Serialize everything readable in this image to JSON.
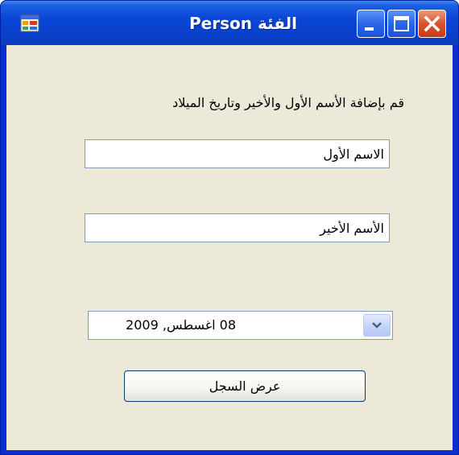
{
  "window": {
    "title": "الفئة Person",
    "minimize_icon": "minimize-icon",
    "maximize_icon": "maximize-icon",
    "close_icon": "close-icon",
    "app_icon": "app-window-icon"
  },
  "form": {
    "instruction": "قم بإضافة الأسم الأول والأخير وتاريخ الميلاد",
    "first_name_value": "الاسم الأول",
    "last_name_value": "الأسم الأخير",
    "birth_date_value": "08 اغسطس, 2009",
    "dropdown_icon": "chevron-down-icon",
    "show_record_label": "عرض السجل"
  },
  "colors": {
    "titlebar": "#0a46d6",
    "client_bg": "#ece9d8",
    "close_button": "#d9532c",
    "input_border": "#7f9db9"
  }
}
